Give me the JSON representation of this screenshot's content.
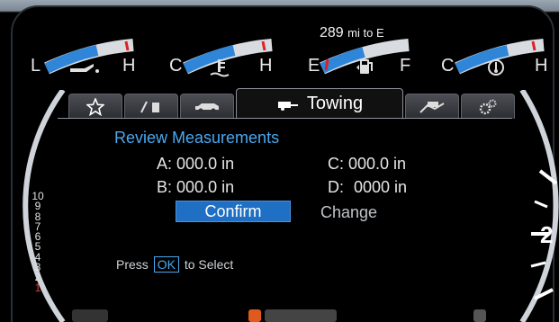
{
  "gauges": [
    {
      "name": "oil",
      "left_label": "L",
      "right_label": "H",
      "icon": "oil-can-icon",
      "fill": 0.55
    },
    {
      "name": "coolant",
      "left_label": "C",
      "right_label": "H",
      "icon": "coolant-temp-icon",
      "fill": 0.5
    },
    {
      "name": "fuel",
      "left_label": "E",
      "right_label": "F",
      "icon": "fuel-pump-icon",
      "fill": 0.45
    },
    {
      "name": "trans",
      "left_label": "C",
      "right_label": "H",
      "icon": "transmission-temp-icon",
      "fill": 0.55
    }
  ],
  "range": {
    "value": "289",
    "unit": "mi to E"
  },
  "tabs": [
    {
      "icon": "star-icon"
    },
    {
      "icon": "fuel-economy-icon"
    },
    {
      "icon": "vehicle-icon"
    },
    {
      "icon": "trailer-towing-icon",
      "label": "Towing",
      "active": true
    },
    {
      "icon": "offroad-icon"
    },
    {
      "icon": "settings-gears-icon"
    }
  ],
  "screen": {
    "title": "Review Measurements",
    "a_label": "A:",
    "a_value": "000.0 in",
    "b_label": "B:",
    "b_value": "000.0 in",
    "c_label": "C:",
    "c_value": "000.0 in",
    "d_label": "D:",
    "d_value": "0000 in",
    "confirm_label": "Confirm",
    "change_label": "Change",
    "hint_press": "Press",
    "hint_ok": "OK",
    "hint_rest": "to Select"
  },
  "left_scale": [
    "10",
    "9",
    "8",
    "7",
    "6",
    "5",
    "4",
    "3",
    "2",
    "1"
  ],
  "right_gauge_number": "2",
  "colors": {
    "accent": "#4aa8f0",
    "confirm": "#1f6fc4",
    "gauge_fill": "#2f86d8",
    "redline": "#e02020"
  }
}
